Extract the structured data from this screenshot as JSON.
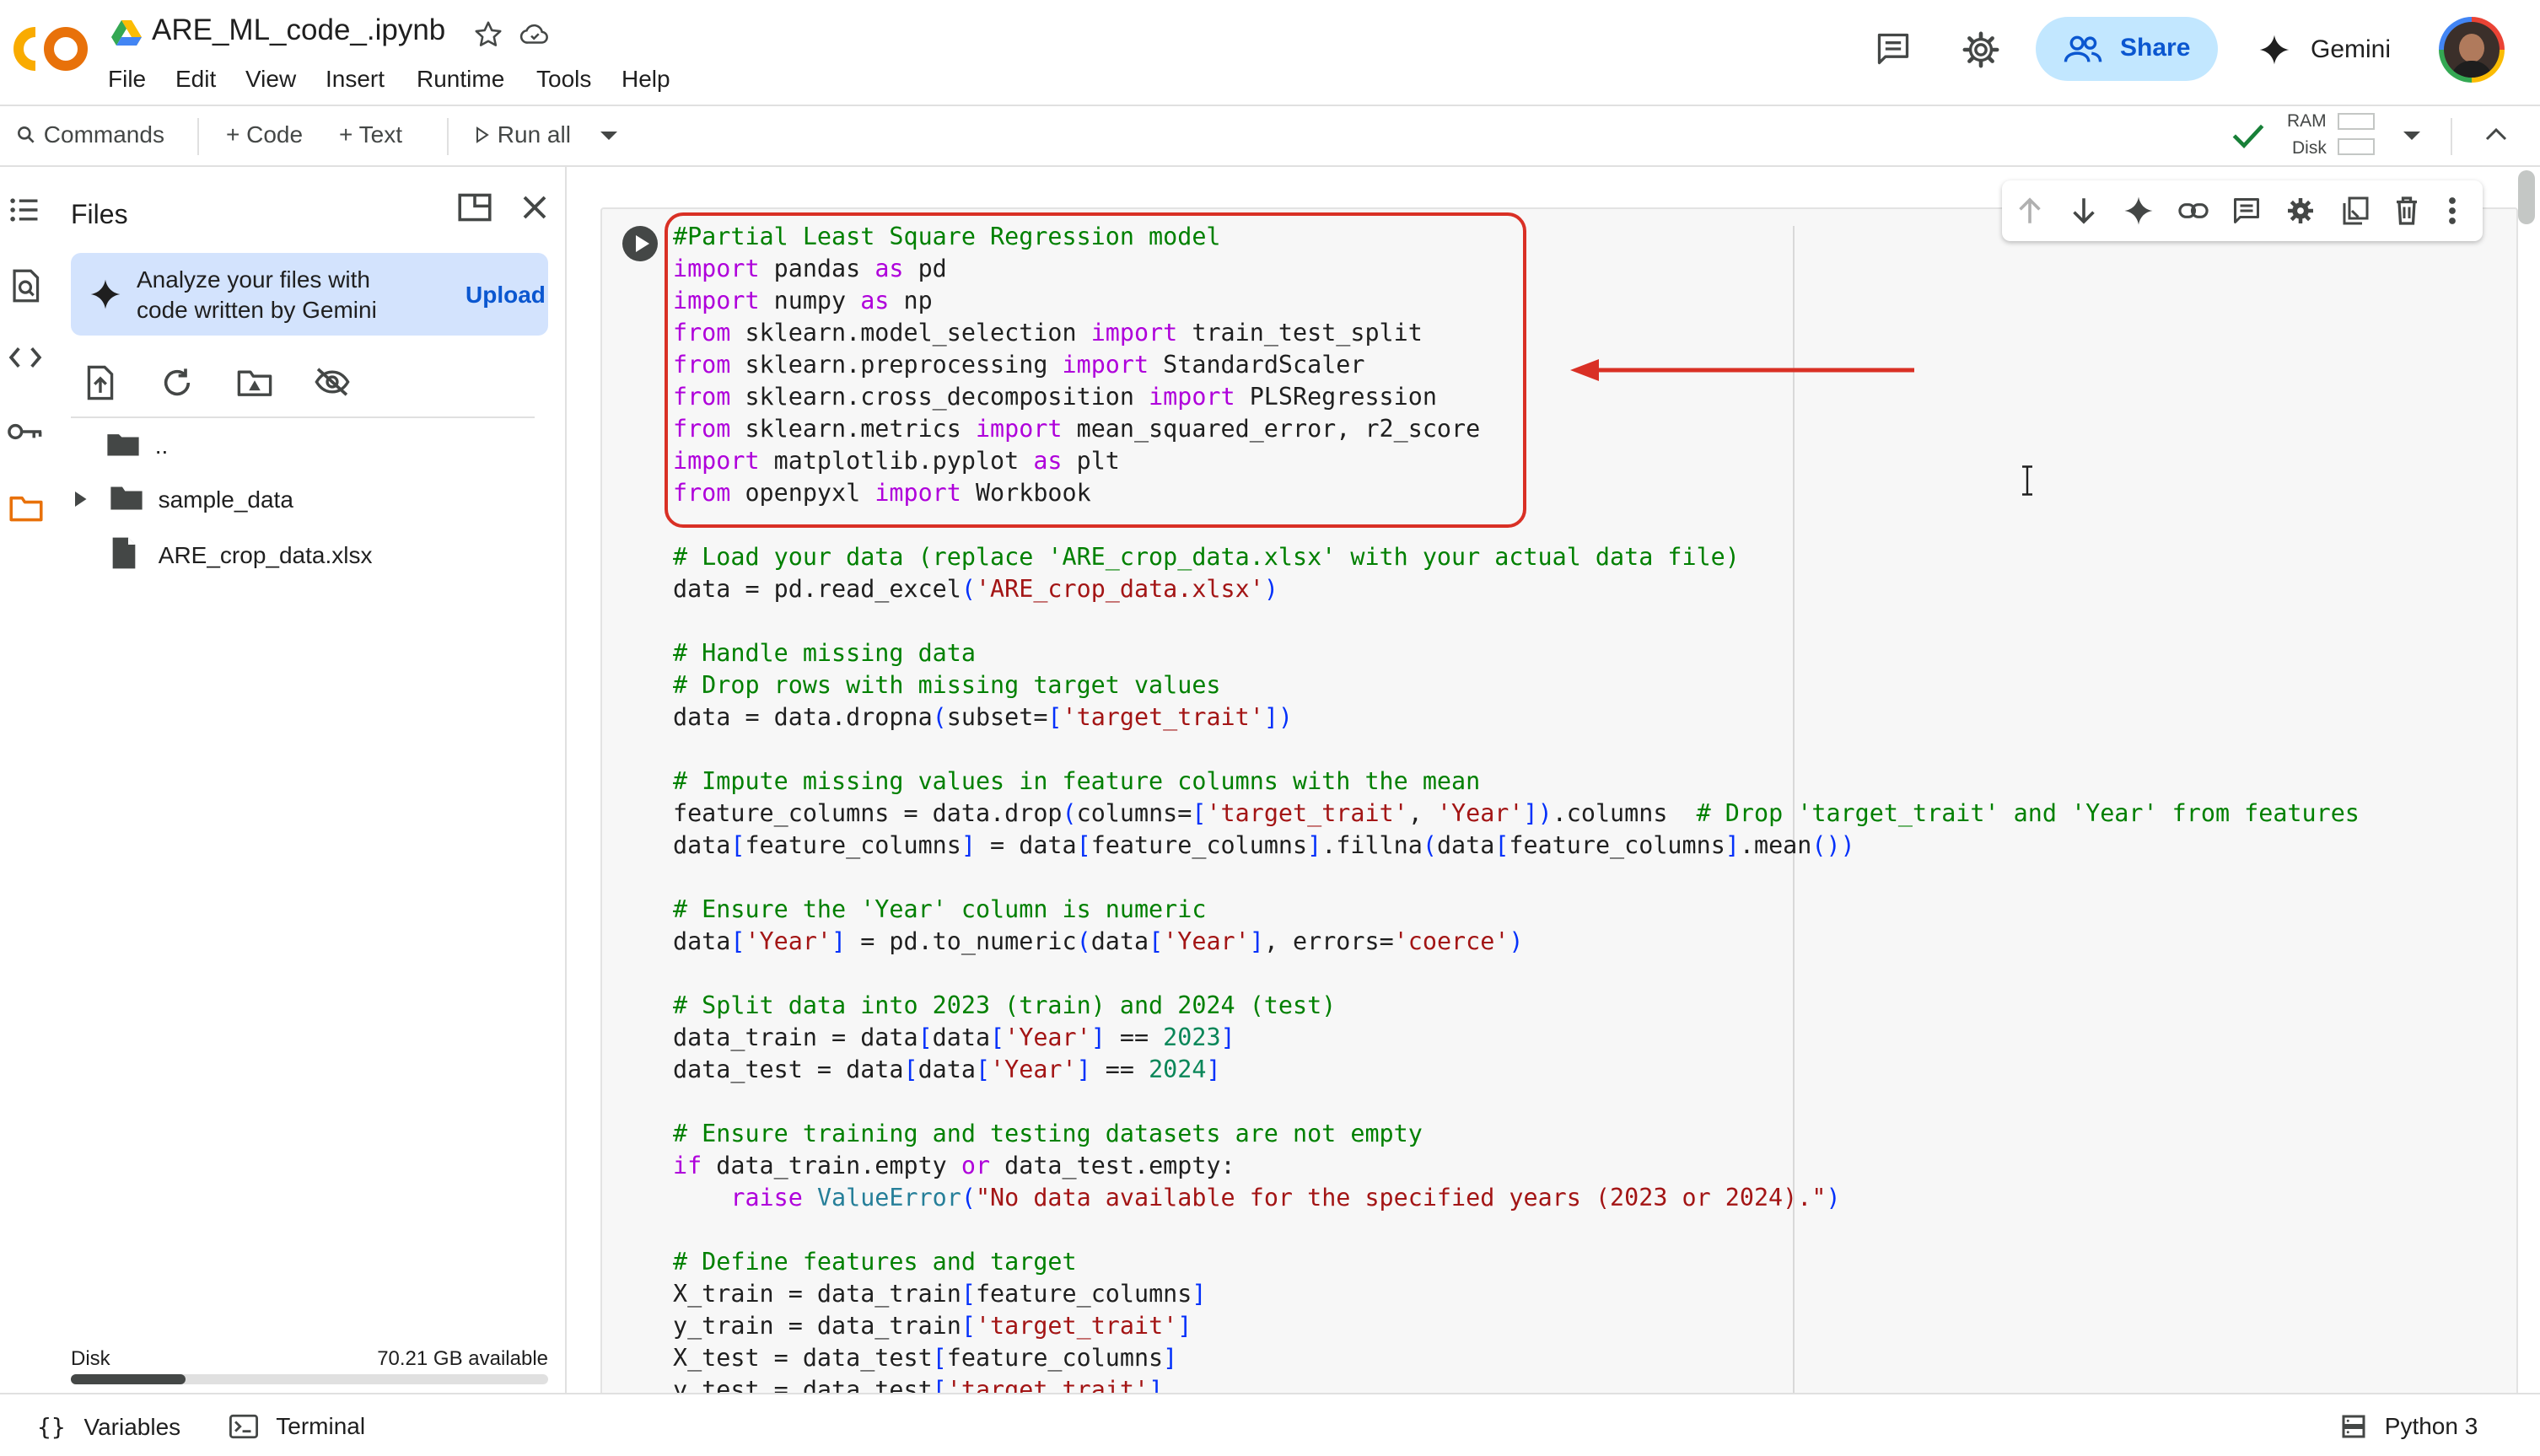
{
  "header": {
    "title": "ARE_ML_code_.ipynb",
    "menu": [
      "File",
      "Edit",
      "View",
      "Insert",
      "Runtime",
      "Tools",
      "Help"
    ],
    "share_label": "Share",
    "gemini_label": "Gemini"
  },
  "toolbar": {
    "commands": "Commands",
    "code": "+ Code",
    "text": "+ Text",
    "run_all": "Run all",
    "ram_label": "RAM",
    "disk_label": "Disk"
  },
  "files": {
    "title": "Files",
    "banner_text": "Analyze your files with code written by Gemini",
    "banner_line1": "Analyze your files with",
    "banner_line2": "code written by Gemini",
    "upload": "Upload",
    "items": [
      {
        "label": "..",
        "type": "folder-up"
      },
      {
        "label": "sample_data",
        "type": "folder"
      },
      {
        "label": "ARE_crop_data.xlsx",
        "type": "file"
      }
    ],
    "disk_label": "Disk",
    "disk_available": "70.21 GB available",
    "disk_used_fraction": 0.24
  },
  "code_lines": [
    "#Partial Least Square Regression model",
    "import pandas as pd",
    "import numpy as np",
    "from sklearn.model_selection import train_test_split",
    "from sklearn.preprocessing import StandardScaler",
    "from sklearn.cross_decomposition import PLSRegression",
    "from sklearn.metrics import mean_squared_error, r2_score",
    "import matplotlib.pyplot as plt",
    "from openpyxl import Workbook",
    "",
    "# Load your data (replace 'ARE_crop_data.xlsx' with your actual data file)",
    "data = pd.read_excel('ARE_crop_data.xlsx')",
    "",
    "# Handle missing data",
    "# Drop rows with missing target values",
    "data = data.dropna(subset=['target_trait'])",
    "",
    "# Impute missing values in feature columns with the mean",
    "feature_columns = data.drop(columns=['target_trait', 'Year']).columns  # Drop 'target_trait' and 'Year' from features",
    "data[feature_columns] = data[feature_columns].fillna(data[feature_columns].mean())",
    "",
    "# Ensure the 'Year' column is numeric",
    "data['Year'] = pd.to_numeric(data['Year'], errors='coerce')",
    "",
    "# Split data into 2023 (train) and 2024 (test)",
    "data_train = data[data['Year'] == 2023]",
    "data_test = data[data['Year'] == 2024]",
    "",
    "# Ensure training and testing datasets are not empty",
    "if data_train.empty or data_test.empty:",
    "    raise ValueError(\"No data available for the specified years (2023 or 2024).\")",
    "",
    "# Define features and target",
    "X_train = data_train[feature_columns]",
    "y_train = data_train['target_trait']",
    "X_test = data_test[feature_columns]",
    "y_test = data_test['target_trait']"
  ],
  "status_bar": {
    "variables": "Variables",
    "terminal": "Terminal",
    "runtime": "Python 3"
  },
  "colors": {
    "accent": "#0b57d0",
    "share_bg": "#c2e7ff",
    "banner_bg": "#d3e3fd",
    "highlight": "#d93025",
    "comment": "#008000",
    "keyword": "#af00db",
    "string": "#a31515",
    "number": "#098658"
  }
}
